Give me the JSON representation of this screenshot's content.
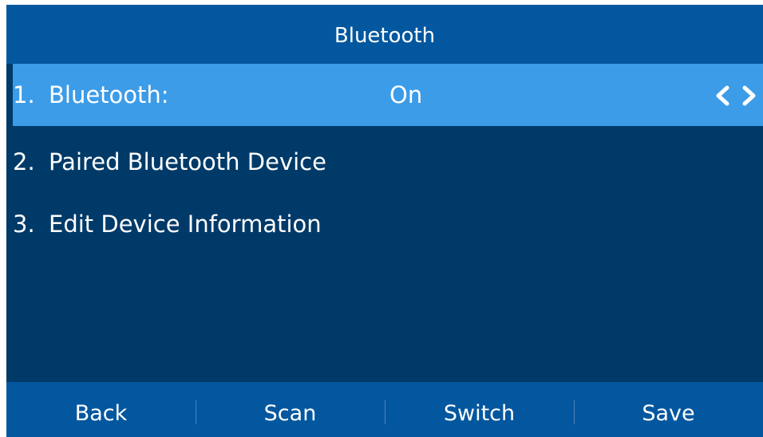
{
  "header": {
    "title": "Bluetooth"
  },
  "menu": {
    "items": [
      {
        "number": "1.",
        "label": "Bluetooth:",
        "value": "On",
        "selected": true
      },
      {
        "number": "2.",
        "label": "Paired Bluetooth Device"
      },
      {
        "number": "3.",
        "label": "Edit Device Information"
      }
    ]
  },
  "softkeys": {
    "back": "Back",
    "scan": "Scan",
    "switch": "Switch",
    "save": "Save"
  },
  "icons": {
    "left": "chevron-left-icon",
    "right": "chevron-right-icon"
  },
  "colors": {
    "screen_background": "#003a68",
    "bar_background": "#03579f",
    "selection_highlight": "#3c9ce8",
    "text": "#ffffff"
  }
}
